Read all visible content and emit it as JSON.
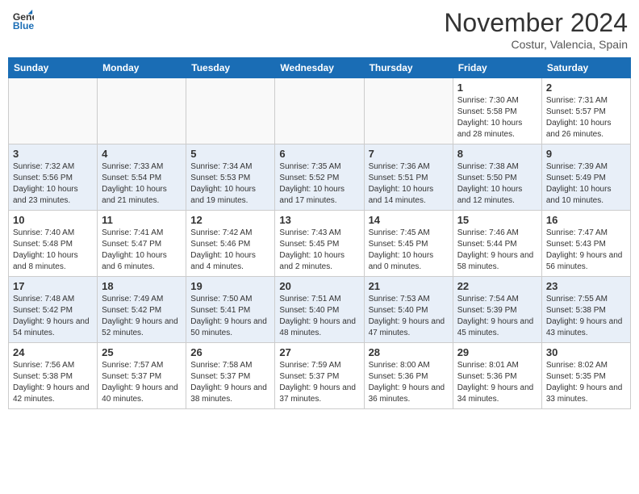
{
  "header": {
    "logo_general": "General",
    "logo_blue": "Blue",
    "month_title": "November 2024",
    "location": "Costur, Valencia, Spain"
  },
  "days_of_week": [
    "Sunday",
    "Monday",
    "Tuesday",
    "Wednesday",
    "Thursday",
    "Friday",
    "Saturday"
  ],
  "weeks": [
    [
      {
        "day": "",
        "info": ""
      },
      {
        "day": "",
        "info": ""
      },
      {
        "day": "",
        "info": ""
      },
      {
        "day": "",
        "info": ""
      },
      {
        "day": "",
        "info": ""
      },
      {
        "day": "1",
        "info": "Sunrise: 7:30 AM\nSunset: 5:58 PM\nDaylight: 10 hours and 28 minutes."
      },
      {
        "day": "2",
        "info": "Sunrise: 7:31 AM\nSunset: 5:57 PM\nDaylight: 10 hours and 26 minutes."
      }
    ],
    [
      {
        "day": "3",
        "info": "Sunrise: 7:32 AM\nSunset: 5:56 PM\nDaylight: 10 hours and 23 minutes."
      },
      {
        "day": "4",
        "info": "Sunrise: 7:33 AM\nSunset: 5:54 PM\nDaylight: 10 hours and 21 minutes."
      },
      {
        "day": "5",
        "info": "Sunrise: 7:34 AM\nSunset: 5:53 PM\nDaylight: 10 hours and 19 minutes."
      },
      {
        "day": "6",
        "info": "Sunrise: 7:35 AM\nSunset: 5:52 PM\nDaylight: 10 hours and 17 minutes."
      },
      {
        "day": "7",
        "info": "Sunrise: 7:36 AM\nSunset: 5:51 PM\nDaylight: 10 hours and 14 minutes."
      },
      {
        "day": "8",
        "info": "Sunrise: 7:38 AM\nSunset: 5:50 PM\nDaylight: 10 hours and 12 minutes."
      },
      {
        "day": "9",
        "info": "Sunrise: 7:39 AM\nSunset: 5:49 PM\nDaylight: 10 hours and 10 minutes."
      }
    ],
    [
      {
        "day": "10",
        "info": "Sunrise: 7:40 AM\nSunset: 5:48 PM\nDaylight: 10 hours and 8 minutes."
      },
      {
        "day": "11",
        "info": "Sunrise: 7:41 AM\nSunset: 5:47 PM\nDaylight: 10 hours and 6 minutes."
      },
      {
        "day": "12",
        "info": "Sunrise: 7:42 AM\nSunset: 5:46 PM\nDaylight: 10 hours and 4 minutes."
      },
      {
        "day": "13",
        "info": "Sunrise: 7:43 AM\nSunset: 5:45 PM\nDaylight: 10 hours and 2 minutes."
      },
      {
        "day": "14",
        "info": "Sunrise: 7:45 AM\nSunset: 5:45 PM\nDaylight: 10 hours and 0 minutes."
      },
      {
        "day": "15",
        "info": "Sunrise: 7:46 AM\nSunset: 5:44 PM\nDaylight: 9 hours and 58 minutes."
      },
      {
        "day": "16",
        "info": "Sunrise: 7:47 AM\nSunset: 5:43 PM\nDaylight: 9 hours and 56 minutes."
      }
    ],
    [
      {
        "day": "17",
        "info": "Sunrise: 7:48 AM\nSunset: 5:42 PM\nDaylight: 9 hours and 54 minutes."
      },
      {
        "day": "18",
        "info": "Sunrise: 7:49 AM\nSunset: 5:42 PM\nDaylight: 9 hours and 52 minutes."
      },
      {
        "day": "19",
        "info": "Sunrise: 7:50 AM\nSunset: 5:41 PM\nDaylight: 9 hours and 50 minutes."
      },
      {
        "day": "20",
        "info": "Sunrise: 7:51 AM\nSunset: 5:40 PM\nDaylight: 9 hours and 48 minutes."
      },
      {
        "day": "21",
        "info": "Sunrise: 7:53 AM\nSunset: 5:40 PM\nDaylight: 9 hours and 47 minutes."
      },
      {
        "day": "22",
        "info": "Sunrise: 7:54 AM\nSunset: 5:39 PM\nDaylight: 9 hours and 45 minutes."
      },
      {
        "day": "23",
        "info": "Sunrise: 7:55 AM\nSunset: 5:38 PM\nDaylight: 9 hours and 43 minutes."
      }
    ],
    [
      {
        "day": "24",
        "info": "Sunrise: 7:56 AM\nSunset: 5:38 PM\nDaylight: 9 hours and 42 minutes."
      },
      {
        "day": "25",
        "info": "Sunrise: 7:57 AM\nSunset: 5:37 PM\nDaylight: 9 hours and 40 minutes."
      },
      {
        "day": "26",
        "info": "Sunrise: 7:58 AM\nSunset: 5:37 PM\nDaylight: 9 hours and 38 minutes."
      },
      {
        "day": "27",
        "info": "Sunrise: 7:59 AM\nSunset: 5:37 PM\nDaylight: 9 hours and 37 minutes."
      },
      {
        "day": "28",
        "info": "Sunrise: 8:00 AM\nSunset: 5:36 PM\nDaylight: 9 hours and 36 minutes."
      },
      {
        "day": "29",
        "info": "Sunrise: 8:01 AM\nSunset: 5:36 PM\nDaylight: 9 hours and 34 minutes."
      },
      {
        "day": "30",
        "info": "Sunrise: 8:02 AM\nSunset: 5:35 PM\nDaylight: 9 hours and 33 minutes."
      }
    ]
  ]
}
